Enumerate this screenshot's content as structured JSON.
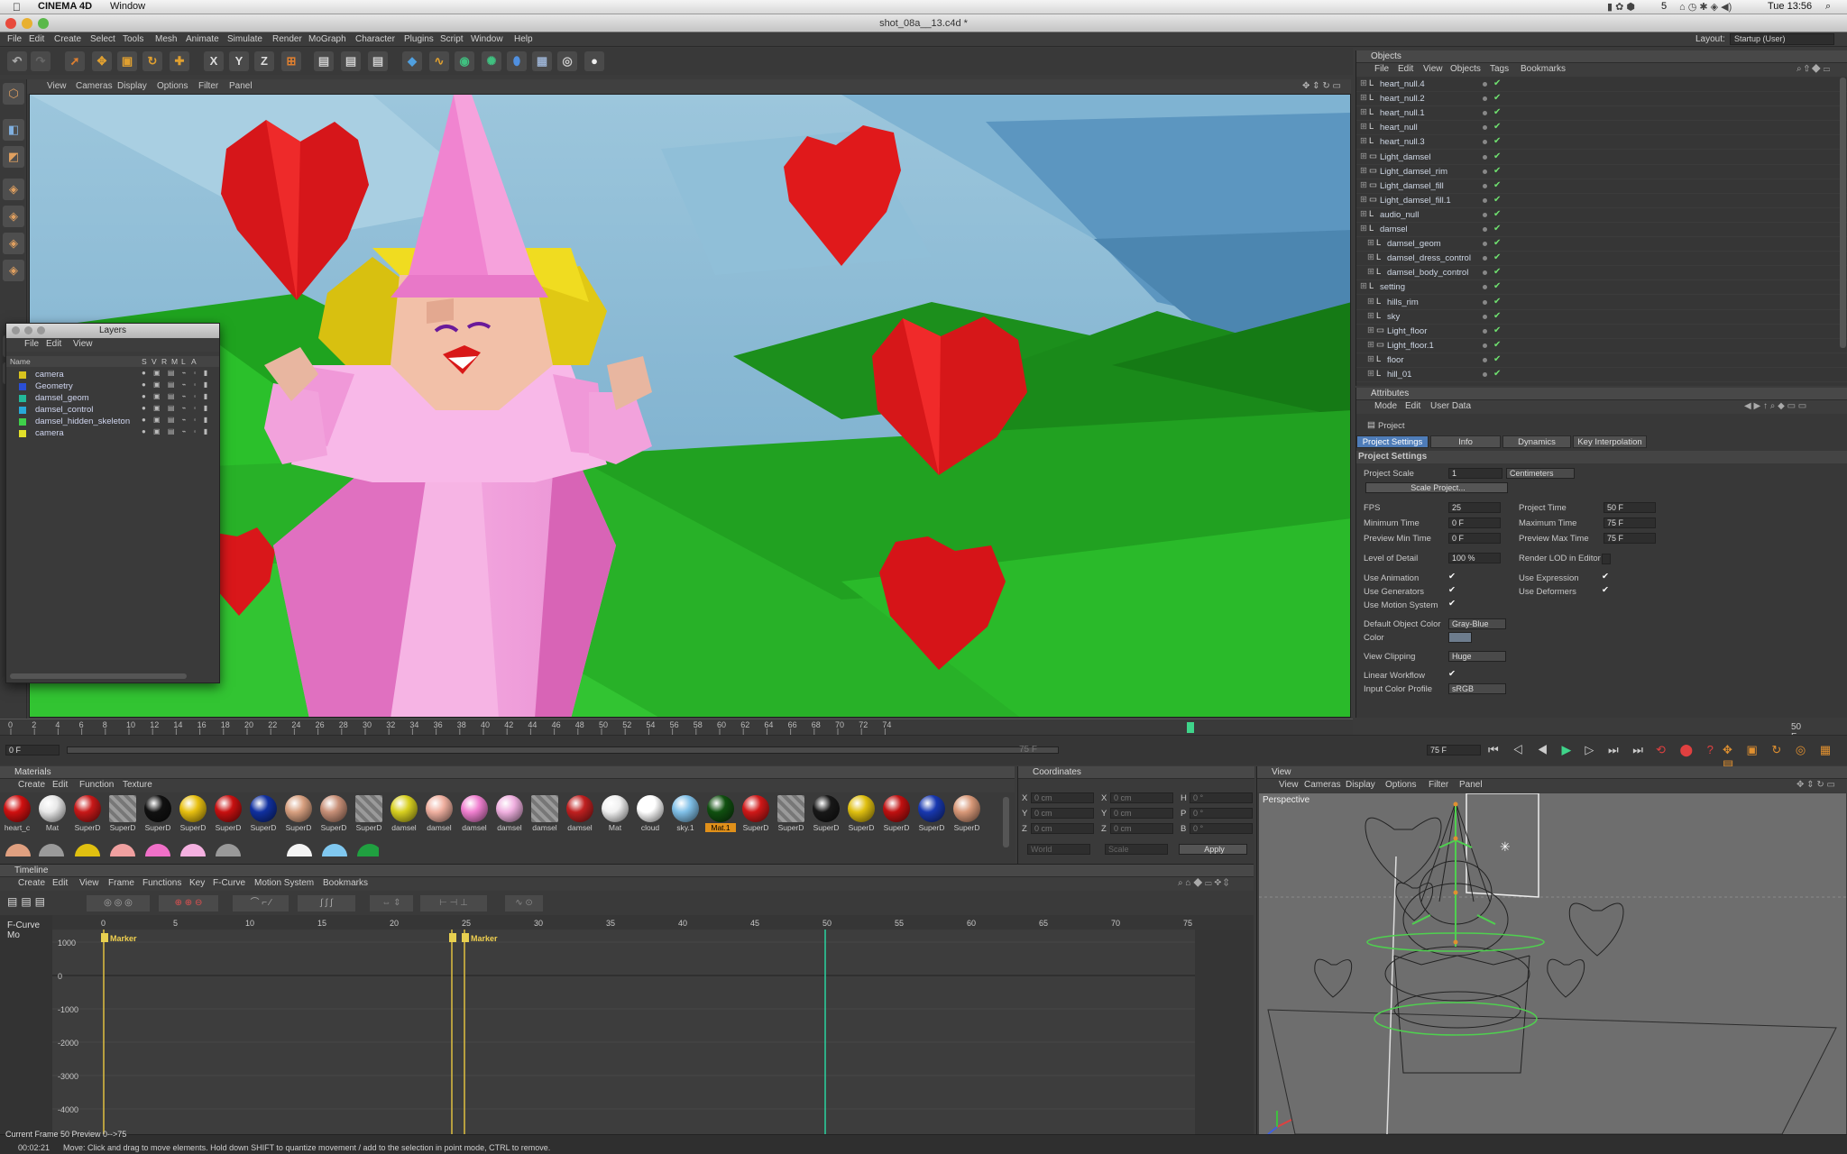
{
  "mac": {
    "app": "CINEMA 4D",
    "window_menu": "Window",
    "clock": "Tue 13:56",
    "badge": "5"
  },
  "window": {
    "title": "shot_08a__13.c4d *"
  },
  "menu": [
    "File",
    "Edit",
    "Create",
    "Select",
    "Tools",
    "Mesh",
    "Animate",
    "Simulate",
    "Render",
    "MoGraph",
    "Character",
    "Plugins",
    "Script",
    "Window",
    "Help"
  ],
  "layout": {
    "label": "Layout:",
    "value": "Startup (User)"
  },
  "viewport": {
    "menu": [
      "View",
      "Cameras",
      "Display",
      "Options",
      "Filter",
      "Panel"
    ]
  },
  "axes": {
    "x": "X",
    "y": "Y",
    "z": "Z"
  },
  "timeruler": {
    "ticks": [
      "0",
      "2",
      "4",
      "6",
      "8",
      "10",
      "12",
      "14",
      "16",
      "18",
      "20",
      "22",
      "24",
      "26",
      "28",
      "30",
      "32",
      "34",
      "36",
      "38",
      "40",
      "42",
      "44",
      "46",
      "48",
      "50",
      "52",
      "54",
      "56",
      "58",
      "60",
      "62",
      "64",
      "66",
      "68",
      "70",
      "72",
      "74"
    ],
    "end_field": "50 F",
    "current": "0 F",
    "range_end": "75 F",
    "range_end2": "75 F"
  },
  "layers": {
    "title": "Layers",
    "menu": [
      "File",
      "Edit",
      "View"
    ],
    "col_name": "Name",
    "cols": [
      "S",
      "V",
      "R",
      "M",
      "L",
      "A"
    ],
    "items": [
      {
        "name": "camera",
        "color": "#d8c21e"
      },
      {
        "name": "Geometry",
        "color": "#2a4fd6"
      },
      {
        "name": "damsel_geom",
        "color": "#23b99a"
      },
      {
        "name": "damsel_control",
        "color": "#28a8d8"
      },
      {
        "name": "damsel_hidden_skeleton",
        "color": "#3fd04a"
      },
      {
        "name": "camera",
        "color": "#e2e02a"
      }
    ]
  },
  "objects": {
    "title": "Objects",
    "menu": [
      "File",
      "Edit",
      "View",
      "Objects",
      "Tags",
      "Bookmarks"
    ],
    "items": [
      {
        "name": "heart_null.4",
        "indent": 0
      },
      {
        "name": "heart_null.2",
        "indent": 0
      },
      {
        "name": "heart_null.1",
        "indent": 0
      },
      {
        "name": "heart_null",
        "indent": 0
      },
      {
        "name": "heart_null.3",
        "indent": 0
      },
      {
        "name": "Light_damsel",
        "indent": 0
      },
      {
        "name": "Light_damsel_rim",
        "indent": 0
      },
      {
        "name": "Light_damsel_fill",
        "indent": 0
      },
      {
        "name": "Light_damsel_fill.1",
        "indent": 0
      },
      {
        "name": "audio_null",
        "indent": 0
      },
      {
        "name": "damsel",
        "indent": 0
      },
      {
        "name": "damsel_geom",
        "indent": 1
      },
      {
        "name": "damsel_dress_control",
        "indent": 1
      },
      {
        "name": "damsel_body_control",
        "indent": 1
      },
      {
        "name": "setting",
        "indent": 0
      },
      {
        "name": "hills_rim",
        "indent": 1
      },
      {
        "name": "sky",
        "indent": 1
      },
      {
        "name": "Light_floor",
        "indent": 1
      },
      {
        "name": "Light_floor.1",
        "indent": 1
      },
      {
        "name": "floor",
        "indent": 1
      },
      {
        "name": "hill_01",
        "indent": 1
      }
    ]
  },
  "attributes": {
    "title": "Attributes",
    "menu": [
      "Mode",
      "Edit",
      "User Data"
    ],
    "object": "Project",
    "tabs": [
      "Project Settings",
      "Info",
      "Dynamics",
      "Key Interpolation"
    ],
    "section": "Project Settings",
    "project_scale_label": "Project Scale",
    "project_scale": "1",
    "scale_unit": "Centimeters",
    "scale_btn": "Scale Project...",
    "fps_label": "FPS",
    "fps": "25",
    "proj_time_label": "Project Time",
    "proj_time": "50 F",
    "min_time_label": "Minimum Time",
    "min_time": "0 F",
    "max_time_label": "Maximum Time",
    "max_time": "75 F",
    "prev_min_label": "Preview Min Time",
    "prev_min": "0 F",
    "prev_max_label": "Preview Max Time",
    "prev_max": "75 F",
    "lod_label": "Level of Detail",
    "lod": "100 %",
    "render_lod_label": "Render LOD in Editor",
    "use_anim": "Use Animation",
    "use_expr": "Use Expression",
    "use_gen": "Use Generators",
    "use_def": "Use Deformers",
    "use_motion": "Use Motion System",
    "def_color_label": "Default Object Color",
    "def_color": "Gray-Blue",
    "color_label": "Color",
    "clip_label": "View Clipping",
    "clip": "Huge",
    "linear_label": "Linear Workflow",
    "icp_label": "Input Color Profile",
    "icp": "sRGB"
  },
  "materials": {
    "title": "Materials",
    "menu": [
      "Create",
      "Edit",
      "Function",
      "Texture"
    ],
    "items": [
      {
        "n": "heart_c",
        "c": "#d01010"
      },
      {
        "n": "Mat",
        "c": "#e8e8e8"
      },
      {
        "n": "SuperD",
        "c": "#c81818"
      },
      {
        "n": "SuperD",
        "c": "striped"
      },
      {
        "n": "SuperD",
        "c": "#111111"
      },
      {
        "n": "SuperD",
        "c": "#e8c010"
      },
      {
        "n": "SuperD",
        "c": "#c81010"
      },
      {
        "n": "SuperD",
        "c": "#1030a0"
      },
      {
        "n": "SuperD",
        "c": "#d8a080"
      },
      {
        "n": "SuperD",
        "c": "#c89078"
      },
      {
        "n": "SuperD",
        "c": "striped"
      },
      {
        "n": "damsel",
        "c": "#d8d020"
      },
      {
        "n": "damsel",
        "c": "#f0b0a0"
      },
      {
        "n": "damsel",
        "c": "#f080d0"
      },
      {
        "n": "damsel",
        "c": "#f0b0e0"
      },
      {
        "n": "damsel",
        "c": "striped"
      },
      {
        "n": "damsel",
        "c": "#c02020"
      },
      {
        "n": "Mat",
        "c": "#f0f0f0"
      },
      {
        "n": "cloud",
        "c": "#ffffff"
      },
      {
        "n": "sky.1",
        "c": "#80c0e8"
      },
      {
        "n": "Mat.1",
        "c": "#105010"
      },
      {
        "n": "SuperD",
        "c": "#d01818"
      },
      {
        "n": "SuperD",
        "c": "striped"
      },
      {
        "n": "SuperD",
        "c": "#181818"
      },
      {
        "n": "SuperD",
        "c": "#e0c010"
      },
      {
        "n": "SuperD",
        "c": "#c01010"
      },
      {
        "n": "SuperD",
        "c": "#1838b0"
      },
      {
        "n": "SuperD",
        "c": "#d89878"
      }
    ]
  },
  "coords": {
    "title": "Coordinates",
    "rows": [
      [
        "X",
        "0 cm",
        "X",
        "0 cm",
        "H",
        "0 °"
      ],
      [
        "Y",
        "0 cm",
        "Y",
        "0 cm",
        "P",
        "0 °"
      ],
      [
        "Z",
        "0 cm",
        "Z",
        "0 cm",
        "B",
        "0 °"
      ]
    ],
    "mode1": "World",
    "mode2": "Scale",
    "apply": "Apply"
  },
  "timeline": {
    "title": "Timeline",
    "menu": [
      "Create",
      "Edit",
      "View",
      "Frame",
      "Functions",
      "Key",
      "F-Curve",
      "Motion System",
      "Bookmarks"
    ],
    "mode": "F-Curve Mo",
    "frames": [
      "0",
      "5",
      "10",
      "15",
      "20",
      "25",
      "30",
      "35",
      "40",
      "45",
      "50",
      "55",
      "60",
      "65",
      "70",
      "75"
    ],
    "yvals": [
      "1000",
      "0",
      "-1000",
      "-2000",
      "-3000",
      "-4000"
    ],
    "marker1": "Marker",
    "marker2": "Marker"
  },
  "view2": {
    "title": "View",
    "menu": [
      "View",
      "Cameras",
      "Display",
      "Options",
      "Filter",
      "Panel"
    ],
    "label": "Perspective"
  },
  "status": {
    "time": "00:02:21",
    "text": "Move: Click and drag to move elements. Hold down SHIFT to quantize movement / add to the selection in point mode, CTRL to remove.",
    "frame_info": "Current Frame  50  Preview  0-->75"
  }
}
